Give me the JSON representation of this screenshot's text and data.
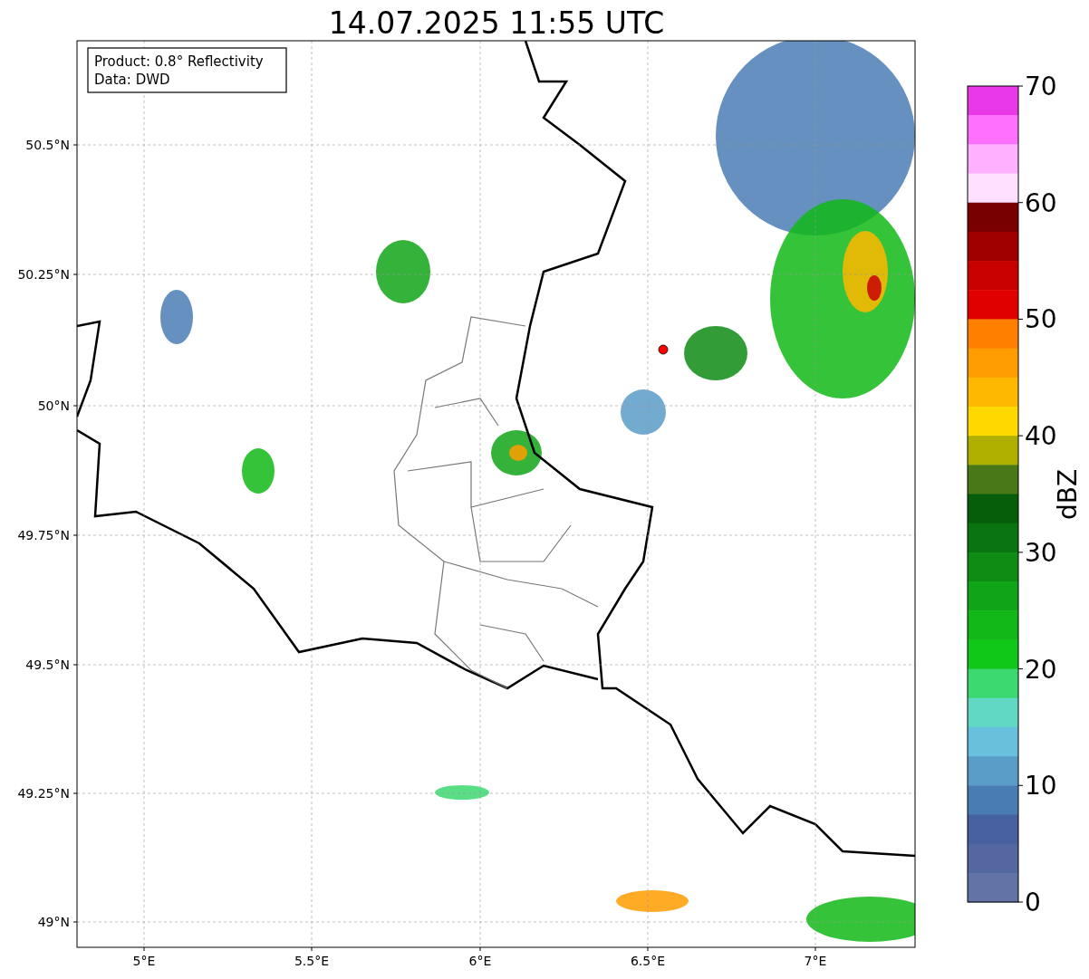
{
  "title": "14.07.2025 11:55 UTC",
  "legend": {
    "lines": [
      "Product: 0.8° Reflectivity",
      "Data: DWD"
    ]
  },
  "y_ticks": [
    "50.5°N",
    "50.25°N",
    "50°N",
    "49.75°N",
    "49.5°N",
    "49.25°N",
    "49°N"
  ],
  "x_ticks": [
    "5°E",
    "5.5°E",
    "6°E",
    "6.5°E",
    "7°E"
  ],
  "colorbar": {
    "label": "dBZ",
    "ticks": [
      "70",
      "60",
      "50",
      "40",
      "30",
      "20",
      "10",
      "0"
    ],
    "bins": [
      {
        "color": "#e838e8"
      },
      {
        "color": "#ff70ff"
      },
      {
        "color": "#ffb0ff"
      },
      {
        "color": "#ffe0ff"
      },
      {
        "color": "#780000"
      },
      {
        "color": "#a00000"
      },
      {
        "color": "#c80000"
      },
      {
        "color": "#e00000"
      },
      {
        "color": "#ff8000"
      },
      {
        "color": "#ff9c00"
      },
      {
        "color": "#ffb800"
      },
      {
        "color": "#ffd800"
      },
      {
        "color": "#b0b000"
      },
      {
        "color": "#487818"
      },
      {
        "color": "#065e0a"
      },
      {
        "color": "#0a7410"
      },
      {
        "color": "#0e8c14"
      },
      {
        "color": "#10a418"
      },
      {
        "color": "#12b818"
      },
      {
        "color": "#10c818"
      },
      {
        "color": "#3cd870"
      },
      {
        "color": "#60d8c4"
      },
      {
        "color": "#68c0dc"
      },
      {
        "color": "#5a9cc8"
      },
      {
        "color": "#4a7cb4"
      },
      {
        "color": "#4660a0"
      },
      {
        "color": "#5567a0"
      },
      {
        "color": "#6473a6"
      }
    ]
  }
}
